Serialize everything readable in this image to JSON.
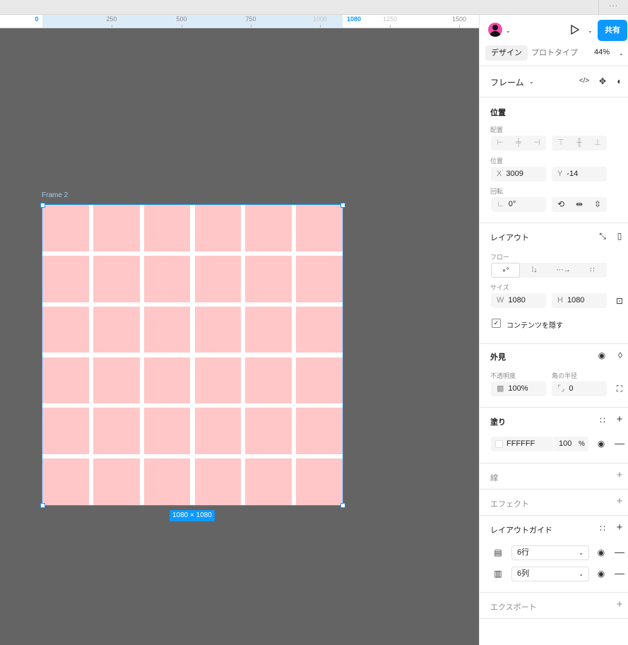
{
  "ruler": {
    "ticks": [
      "0",
      "250",
      "500",
      "750",
      "1000",
      "1080",
      "1250",
      "1500"
    ]
  },
  "canvas": {
    "frame_label": "Frame 2",
    "dimension_badge": "1080 × 1080",
    "grid": {
      "rows": 6,
      "columns": 6
    },
    "colors": {
      "canvas": "#646464",
      "grid_cell": "#ffc7c7",
      "selection": "#0d99ff"
    }
  },
  "header": {
    "share_label": "共有",
    "tabs": [
      "デザイン",
      "プロトタイプ"
    ],
    "zoom": "44%"
  },
  "frame_section": {
    "title": "フレーム"
  },
  "position": {
    "title": "位置",
    "align_label": "配置",
    "pos_label": "位置",
    "x_label": "X",
    "x_value": "3009",
    "y_label": "Y",
    "y_value": "-14",
    "rotation_label": "回転",
    "rotation_value": "0°"
  },
  "layout": {
    "title": "レイアウト",
    "flow_label": "フロー",
    "size_label": "サイズ",
    "w_label": "W",
    "w_value": "1080",
    "h_label": "H",
    "h_value": "1080",
    "clip_label": "コンテンツを隠す"
  },
  "appearance": {
    "title": "外見",
    "opacity_label": "不透明度",
    "opacity_value": "100%",
    "radius_label": "角の半径",
    "radius_value": "0"
  },
  "fill": {
    "title": "塗り",
    "hex": "FFFFFF",
    "opacity": "100",
    "percent": "%"
  },
  "stroke": {
    "title": "線"
  },
  "effects": {
    "title": "エフェクト"
  },
  "layout_guide": {
    "title": "レイアウトガイド",
    "rows_value": "6行",
    "cols_value": "6列"
  },
  "export": {
    "title": "エクスポート"
  }
}
